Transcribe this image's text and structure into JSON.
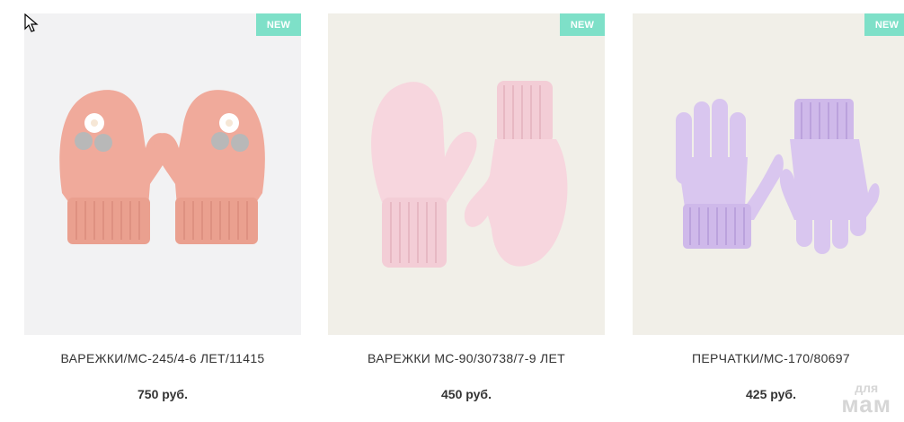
{
  "products": [
    {
      "badge": "NEW",
      "name": "ВАРЕЖКИ/МС-245/4-6 ЛЕТ/11415",
      "price": "750 руб.",
      "image": "pink-knit-mittens-with-flower",
      "colors": {
        "background": "#f2f2f2",
        "item": "#f1aea0"
      }
    },
    {
      "badge": "NEW",
      "name": "ВАРЕЖКИ МС-90/30738/7-9 ЛЕТ",
      "price": "450 руб.",
      "image": "light-pink-mittens",
      "colors": {
        "background": "#f1efe8",
        "item": "#f5d3dc"
      }
    },
    {
      "badge": "NEW",
      "name": "ПЕРЧАТКИ/МС-170/80697",
      "price": "425 руб.",
      "image": "lilac-gloves",
      "colors": {
        "background": "#f1efe8",
        "item": "#d7c4ee"
      }
    }
  ],
  "watermark": {
    "line1": "для",
    "line2": "мам"
  },
  "accent": "#7ee0c8"
}
